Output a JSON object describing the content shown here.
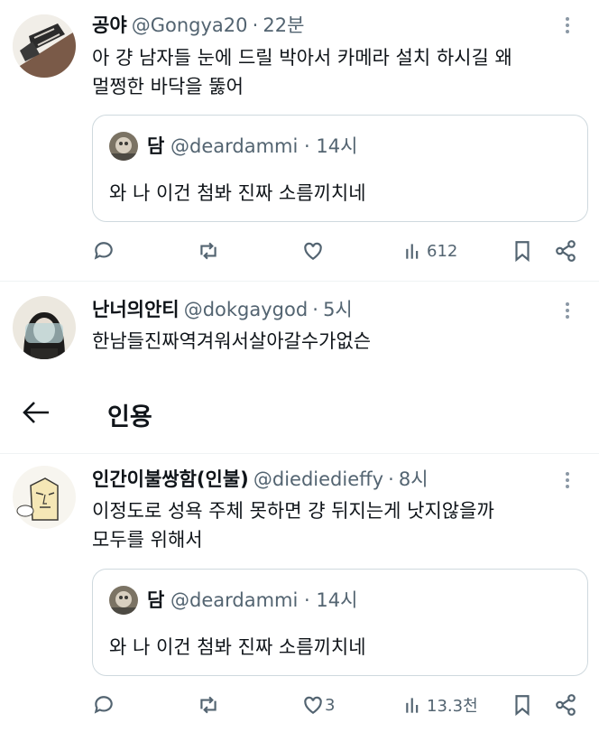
{
  "tweets": [
    {
      "name": "공야",
      "handle": "@Gongya20",
      "time": "22분",
      "text_line1": "아 걍 남자들 눈에 드릴 박아서 카메라 설치 하시길 왜",
      "text_line2": "멀쩡한 바닥을 뚫어",
      "quote": {
        "name": "담",
        "handle": "@deardammi",
        "time": "14시",
        "text": "와 나 이건 첨봐 진짜 소름끼치네"
      },
      "views": "612",
      "likes": ""
    },
    {
      "name": "난너의안티",
      "handle": "@dokgaygod",
      "time": "5시",
      "text_line1": "한남들진짜역겨워서살아갈수가없슨"
    },
    {
      "name": "인간이불쌍함(인불)",
      "handle": "@diediedieffy",
      "time": "8시",
      "text_line1": "이정도로 성욕 주체 못하면 걍 뒤지는게 낫지않을까",
      "text_line2": "모두를 위해서",
      "quote": {
        "name": "담",
        "handle": "@deardammi",
        "time": "14시",
        "text": "와 나 이건 첨봐 진짜 소름끼치네"
      },
      "views": "13.3천",
      "likes": "3"
    }
  ],
  "page_header": {
    "title": "인용"
  },
  "separator": "·",
  "icons": [
    "reply-icon",
    "retweet-icon",
    "heart-icon",
    "views-icon",
    "bookmark-icon",
    "share-icon",
    "back-arrow-icon",
    "more-icon"
  ],
  "colors": {
    "muted": "#536471",
    "border": "#cfd9de",
    "text": "#0f1419"
  }
}
